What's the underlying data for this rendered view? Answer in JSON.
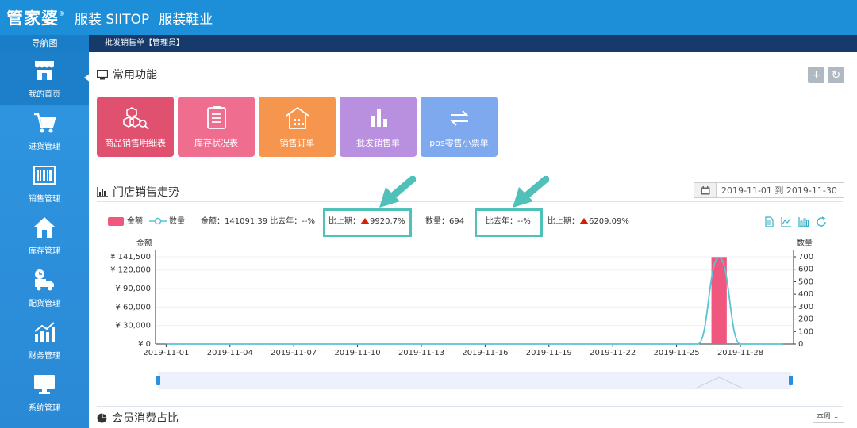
{
  "app": {
    "logo": "管家婆",
    "logo_mark": "®",
    "product": "服装 SIITOP",
    "industry": "服装鞋业"
  },
  "sidebar": {
    "title": "导航图",
    "items": [
      {
        "label": "我的首页",
        "icon": "store-icon"
      },
      {
        "label": "进货管理",
        "icon": "cart-icon"
      },
      {
        "label": "销售管理",
        "icon": "barcode-icon"
      },
      {
        "label": "库存管理",
        "icon": "house-icon"
      },
      {
        "label": "配货管理",
        "icon": "truck-icon"
      },
      {
        "label": "财务管理",
        "icon": "finance-chart-icon"
      },
      {
        "label": "系统管理",
        "icon": "monitor-icon"
      }
    ]
  },
  "breadcrumb": "批发销售单【管理员】",
  "quick": {
    "title": "常用功能",
    "add_label": "+",
    "refresh_label": "↻",
    "tiles": [
      {
        "label": "商品销售明细表",
        "color": "#e0506f"
      },
      {
        "label": "库存状况表",
        "color": "#ef6e90"
      },
      {
        "label": "销售订单",
        "color": "#f6964e"
      },
      {
        "label": "批发销售单",
        "color": "#b98fe0"
      },
      {
        "label": "pos零售小票单",
        "color": "#7ea9ee"
      }
    ]
  },
  "trend": {
    "title": "门店销售走势",
    "date_range": "2019-11-01 到 2019-11-30",
    "legend_amount": "金额",
    "legend_qty": "数量",
    "amount_label": "金额：",
    "amount_value": "141091.39",
    "amount_yoy_label": "比去年：",
    "amount_yoy_value": "--%",
    "amount_mom_label": "比上期：",
    "amount_mom_value": "9920.7%",
    "qty_label": "数量：",
    "qty_value": "694",
    "qty_yoy_label": "比去年：",
    "qty_yoy_value": "--%",
    "qty_mom_label": "比上期：",
    "qty_mom_value": "6209.09%"
  },
  "member": {
    "title": "会员消费占比",
    "period": "本周"
  },
  "colors": {
    "topbar": "#1c8fd8",
    "sidebar": "#2a8fdc",
    "breadcrumb_bar": "#163b6b",
    "amount_series": "#f0577f",
    "qty_series": "#58c3d6",
    "highlight_box": "#4fc1b8",
    "up_arrow": "#d81e06"
  },
  "chart_data": {
    "type": "bar",
    "ylabel": "金额",
    "y2label": "数量",
    "x_tick_labels": [
      "2019-11-01",
      "2019-11-04",
      "2019-11-07",
      "2019-11-10",
      "2019-11-13",
      "2019-11-16",
      "2019-11-19",
      "2019-11-22",
      "2019-11-25",
      "2019-11-28"
    ],
    "y_tick_labels": [
      "¥ 0",
      "¥ 30,000",
      "¥ 60,000",
      "¥ 90,000",
      "¥ 120,000",
      "¥ 141,500"
    ],
    "y2_tick_labels": [
      "0",
      "100",
      "200",
      "300",
      "400",
      "500",
      "600",
      "700"
    ],
    "ylim": [
      0,
      141500
    ],
    "y2lim": [
      0,
      700
    ],
    "categories": [
      "2019-11-01",
      "2019-11-02",
      "2019-11-03",
      "2019-11-04",
      "2019-11-05",
      "2019-11-06",
      "2019-11-07",
      "2019-11-08",
      "2019-11-09",
      "2019-11-10",
      "2019-11-11",
      "2019-11-12",
      "2019-11-13",
      "2019-11-14",
      "2019-11-15",
      "2019-11-16",
      "2019-11-17",
      "2019-11-18",
      "2019-11-19",
      "2019-11-20",
      "2019-11-21",
      "2019-11-22",
      "2019-11-23",
      "2019-11-24",
      "2019-11-25",
      "2019-11-26",
      "2019-11-27",
      "2019-11-28",
      "2019-11-29",
      "2019-11-30"
    ],
    "series": [
      {
        "name": "金额",
        "type": "bar",
        "axis": "left",
        "values": [
          0,
          0,
          0,
          0,
          0,
          0,
          0,
          0,
          0,
          0,
          0,
          0,
          0,
          0,
          0,
          0,
          0,
          0,
          0,
          0,
          0,
          0,
          0,
          0,
          0,
          0,
          141091.39,
          0,
          0,
          0
        ]
      },
      {
        "name": "数量",
        "type": "line",
        "axis": "right",
        "values": [
          0,
          0,
          0,
          0,
          0,
          0,
          0,
          0,
          0,
          0,
          0,
          0,
          0,
          0,
          0,
          0,
          0,
          0,
          0,
          0,
          0,
          0,
          0,
          0,
          0,
          0,
          694,
          0,
          0,
          0
        ]
      }
    ],
    "grid": true,
    "legend": "top-left"
  }
}
